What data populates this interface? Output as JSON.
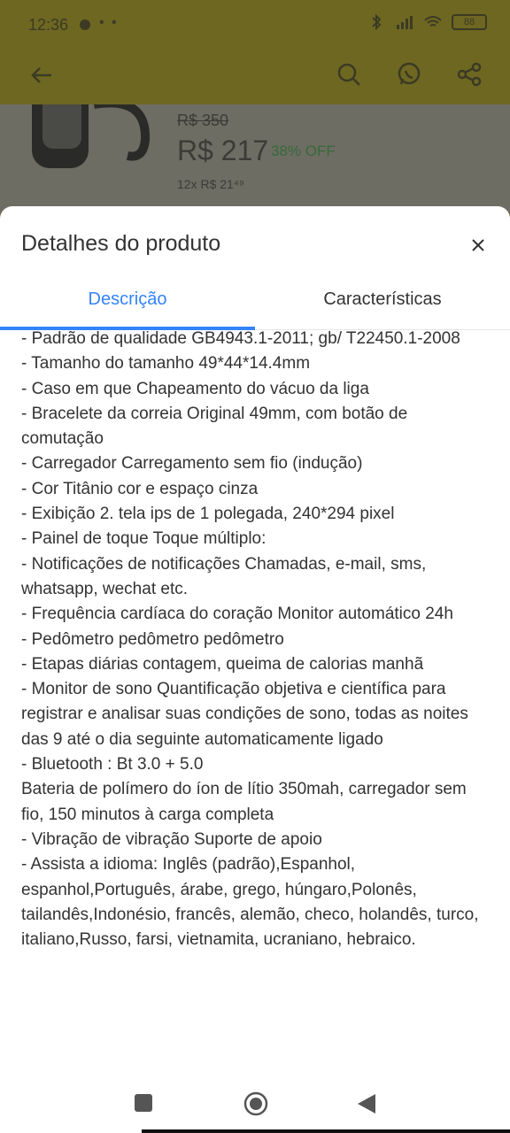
{
  "status_bar": {
    "time": "12:36",
    "battery": "88"
  },
  "product": {
    "old_price": "R$ 350",
    "price": "R$ 217",
    "discount": "38% OFF",
    "installments": "12x R$ 21⁴⁹"
  },
  "sheet": {
    "title": "Detalhes do produto",
    "tabs": [
      {
        "label": "Descrição",
        "active": true
      },
      {
        "label": "Características",
        "active": false
      }
    ],
    "description_lines": [
      "- Padrão de qualidade GB4943.1-2011; gb/ T22450.1-2008",
      "- Tamanho do tamanho 49*44*14.4mm",
      "- Caso em que Chapeamento do vácuo da liga",
      "- Bracelete da correia Original 49mm, com botão de comutação",
      "- Carregador Carregamento sem fio (indução)",
      "- Cor Titânio cor e espaço cinza",
      "- Exibição 2. tela ips de 1 polegada, 240*294 pixel",
      "- Painel de toque Toque múltiplo:",
      "- Notificações de notificações Chamadas, e-mail, sms, whatsapp, wechat etc.",
      "- Frequência cardíaca do coração Monitor automático 24h",
      "- Pedômetro pedômetro pedômetro",
      "- Etapas diárias contagem, queima de calorias manhã",
      "- Monitor de sono Quantificação objetiva e científica para registrar e analisar suas condições de sono, todas as noites das 9 até o dia seguinte automaticamente ligado",
      "- Bluetooth : Bt 3.0 + 5.0",
      "Bateria de polímero do íon de lítio 350mah, carregador sem fio, 150 minutos à carga completa",
      "- Vibração de vibração Suporte de apoio",
      "- Assista a idioma: Inglês (padrão),Espanhol, espanhol,Português, árabe, grego, húngaro,Polonês, tailandês,Indonésio, francês, alemão, checo, holandês, turco, italiano,Russo, farsi, vietnamita, ucraniano, hebraico."
    ]
  },
  "colors": {
    "accent": "#3483fa",
    "text": "#333333",
    "overlay_yellow": "#6d6722"
  },
  "icons": [
    "back-arrow-icon",
    "search-icon",
    "whatsapp-icon",
    "share-icon",
    "close-icon",
    "recent-apps-icon",
    "home-icon",
    "back-nav-icon"
  ]
}
